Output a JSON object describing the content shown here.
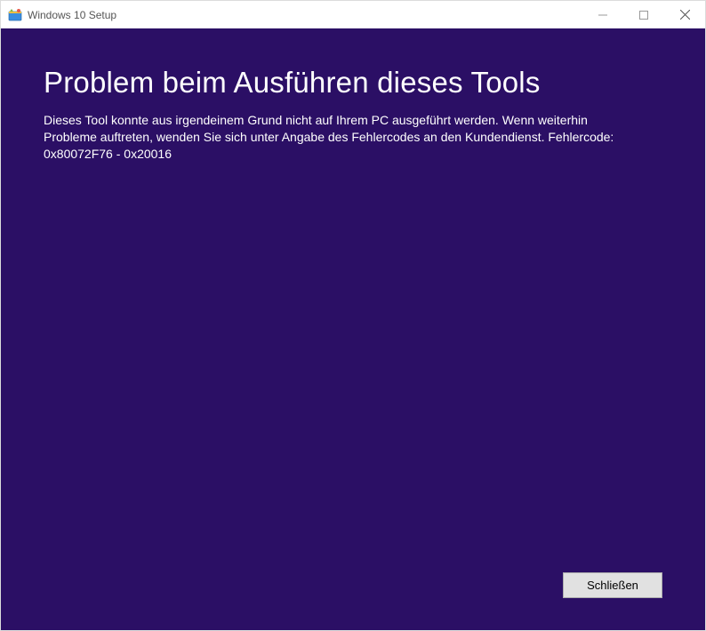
{
  "window": {
    "title": "Windows 10 Setup"
  },
  "main": {
    "heading": "Problem beim Ausführen dieses Tools",
    "body": "Dieses Tool konnte aus irgendeinem Grund nicht auf Ihrem PC ausgeführt werden. Wenn weiterhin Probleme auftreten, wenden Sie sich unter Angabe des Fehlercodes an den Kundendienst. Fehlercode: 0x80072F76 - 0x20016"
  },
  "footer": {
    "close_label": "Schließen"
  },
  "colors": {
    "content_bg": "#2b0f65",
    "text": "#ffffff"
  }
}
